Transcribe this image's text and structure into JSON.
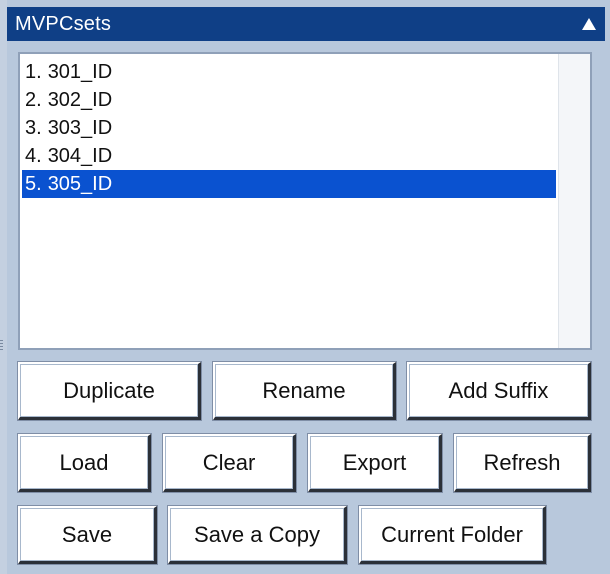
{
  "panel": {
    "title": "MVPCsets",
    "collapse_icon": "triangle-up-icon"
  },
  "list": {
    "items": [
      {
        "number": "1.",
        "label": "301_ID",
        "selected": false
      },
      {
        "number": "2.",
        "label": "302_ID",
        "selected": false
      },
      {
        "number": "3.",
        "label": "303_ID",
        "selected": false
      },
      {
        "number": "4.",
        "label": "304_ID",
        "selected": false
      },
      {
        "number": "5.",
        "label": "305_ID",
        "selected": true
      }
    ]
  },
  "buttons": {
    "duplicate": "Duplicate",
    "rename": "Rename",
    "add_suffix": "Add Suffix",
    "load": "Load",
    "clear": "Clear",
    "export": "Export",
    "refresh": "Refresh",
    "save": "Save",
    "save_copy": "Save a Copy",
    "current_folder": "Current Folder"
  },
  "colors": {
    "titlebar": "#0f3f86",
    "selection": "#0a52d0",
    "background": "#b8c8dc"
  }
}
